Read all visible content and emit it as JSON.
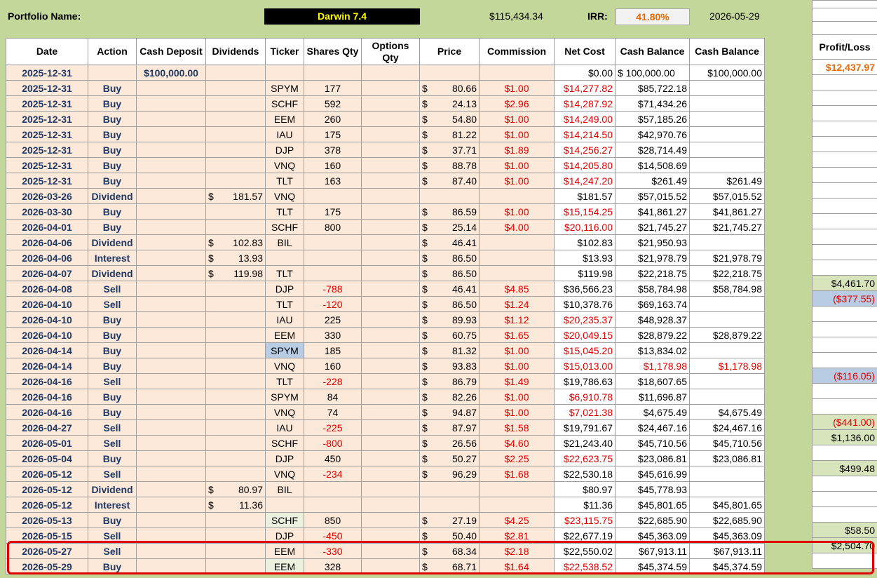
{
  "header": {
    "portfolio_label": "Portfolio Name:",
    "portfolio_name": "Darwin 7.4",
    "total_value": "$115,434.34",
    "irr_label": "IRR:",
    "irr_value": "41.80%",
    "as_of_date": "2026-05-29"
  },
  "columns": [
    "Date",
    "Action",
    "Cash Deposit",
    "Dividends",
    "Ticker",
    "Shares Qty",
    "Options Qty",
    "Price",
    "Commission",
    "Net Cost",
    "Cash Balance",
    "Cash Balance"
  ],
  "profit_loss_header": "Profit/Loss",
  "colors": {
    "sheet_green": "#c4d79b",
    "row_peach": "#fde9d9",
    "negative_red": "#e00000",
    "date_navy": "#1f3864",
    "highlight_red": "#e00000"
  },
  "rows": [
    {
      "date": "2025-12-31",
      "action": "",
      "deposit": "$100,000.00",
      "dividend": "",
      "ticker": "",
      "shares": "",
      "options": "",
      "price": "",
      "commission": "",
      "net_cost": "$0.00",
      "cash_balance": "$ 100,000.00",
      "cash_balance2": "$100,000.00",
      "pl": "$12,437.97",
      "pl_style": "orange"
    },
    {
      "date": "2025-12-31",
      "action": "Buy",
      "deposit": "",
      "dividend": "",
      "ticker": "SPYM",
      "shares": "177",
      "options": "",
      "price": "80.66",
      "commission": "$1.00",
      "net_cost": "$14,277.82",
      "cash_balance": "$85,722.18",
      "cash_balance2": "",
      "pl": ""
    },
    {
      "date": "2025-12-31",
      "action": "Buy",
      "deposit": "",
      "dividend": "",
      "ticker": "SCHF",
      "shares": "592",
      "options": "",
      "price": "24.13",
      "commission": "$2.96",
      "net_cost": "$14,287.92",
      "cash_balance": "$71,434.26",
      "cash_balance2": "",
      "pl": ""
    },
    {
      "date": "2025-12-31",
      "action": "Buy",
      "deposit": "",
      "dividend": "",
      "ticker": "EEM",
      "shares": "260",
      "options": "",
      "price": "54.80",
      "commission": "$1.00",
      "net_cost": "$14,249.00",
      "cash_balance": "$57,185.26",
      "cash_balance2": "",
      "pl": ""
    },
    {
      "date": "2025-12-31",
      "action": "Buy",
      "deposit": "",
      "dividend": "",
      "ticker": "IAU",
      "shares": "175",
      "options": "",
      "price": "81.22",
      "commission": "$1.00",
      "net_cost": "$14,214.50",
      "cash_balance": "$42,970.76",
      "cash_balance2": "",
      "pl": ""
    },
    {
      "date": "2025-12-31",
      "action": "Buy",
      "deposit": "",
      "dividend": "",
      "ticker": "DJP",
      "shares": "378",
      "options": "",
      "price": "37.71",
      "commission": "$1.89",
      "net_cost": "$14,256.27",
      "cash_balance": "$28,714.49",
      "cash_balance2": "",
      "pl": ""
    },
    {
      "date": "2025-12-31",
      "action": "Buy",
      "deposit": "",
      "dividend": "",
      "ticker": "VNQ",
      "shares": "160",
      "options": "",
      "price": "88.78",
      "commission": "$1.00",
      "net_cost": "$14,205.80",
      "cash_balance": "$14,508.69",
      "cash_balance2": "",
      "pl": ""
    },
    {
      "date": "2025-12-31",
      "action": "Buy",
      "deposit": "",
      "dividend": "",
      "ticker": "TLT",
      "shares": "163",
      "options": "",
      "price": "87.40",
      "commission": "$1.00",
      "net_cost": "$14,247.20",
      "cash_balance": "$261.49",
      "cash_balance2": "$261.49",
      "pl": ""
    },
    {
      "date": "2026-03-26",
      "action": "Dividend",
      "deposit": "",
      "dividend": "181.57",
      "ticker": "VNQ",
      "shares": "",
      "options": "",
      "price": "",
      "commission": "",
      "net_cost": "$181.57",
      "cash_balance": "$57,015.52",
      "cash_balance2": "$57,015.52",
      "pl": ""
    },
    {
      "date": "2026-03-30",
      "action": "Buy",
      "deposit": "",
      "dividend": "",
      "ticker": "TLT",
      "shares": "175",
      "options": "",
      "price": "86.59",
      "commission": "$1.00",
      "net_cost": "$15,154.25",
      "cash_balance": "$41,861.27",
      "cash_balance2": "$41,861.27",
      "pl": ""
    },
    {
      "date": "2026-04-01",
      "action": "Buy",
      "deposit": "",
      "dividend": "",
      "ticker": "SCHF",
      "shares": "800",
      "options": "",
      "price": "25.14",
      "commission": "$4.00",
      "net_cost": "$20,116.00",
      "cash_balance": "$21,745.27",
      "cash_balance2": "$21,745.27",
      "pl": ""
    },
    {
      "date": "2026-04-06",
      "action": "Dividend",
      "deposit": "",
      "dividend": "102.83",
      "ticker": "BIL",
      "shares": "",
      "options": "",
      "price": "46.41",
      "commission": "",
      "net_cost": "$102.83",
      "cash_balance": "$21,950.93",
      "cash_balance2": "",
      "pl": ""
    },
    {
      "date": "2026-04-06",
      "action": "Interest",
      "deposit": "",
      "dividend": "13.93",
      "ticker": "",
      "shares": "",
      "options": "",
      "price": "86.50",
      "commission": "",
      "net_cost": "$13.93",
      "cash_balance": "$21,978.79",
      "cash_balance2": "$21,978.79",
      "pl": ""
    },
    {
      "date": "2026-04-07",
      "action": "Dividend",
      "deposit": "",
      "dividend": "119.98",
      "ticker": "TLT",
      "shares": "",
      "options": "",
      "price": "86.50",
      "commission": "",
      "net_cost": "$119.98",
      "cash_balance": "$22,218.75",
      "cash_balance2": "$22,218.75",
      "pl": ""
    },
    {
      "date": "2026-04-08",
      "action": "Sell",
      "deposit": "",
      "dividend": "",
      "ticker": "DJP",
      "shares": "-788",
      "options": "",
      "price": "46.41",
      "commission": "$4.85",
      "net_cost": "$36,566.23",
      "cash_balance": "$58,784.98",
      "cash_balance2": "$58,784.98",
      "pl": "$4,461.70",
      "pl_style": "green"
    },
    {
      "date": "2026-04-10",
      "action": "Sell",
      "deposit": "",
      "dividend": "",
      "ticker": "TLT",
      "shares": "-120",
      "options": "",
      "price": "86.50",
      "commission": "$1.24",
      "net_cost": "$10,378.76",
      "cash_balance": "$69,163.74",
      "cash_balance2": "",
      "pl": "($377.55)",
      "pl_style": "blue"
    },
    {
      "date": "2026-04-10",
      "action": "Buy",
      "deposit": "",
      "dividend": "",
      "ticker": "IAU",
      "shares": "225",
      "options": "",
      "price": "89.93",
      "commission": "$1.12",
      "net_cost": "$20,235.37",
      "cash_balance": "$48,928.37",
      "cash_balance2": "",
      "pl": ""
    },
    {
      "date": "2026-04-10",
      "action": "Buy",
      "deposit": "",
      "dividend": "",
      "ticker": "EEM",
      "shares": "330",
      "options": "",
      "price": "60.75",
      "commission": "$1.65",
      "net_cost": "$20,049.15",
      "cash_balance": "$28,879.22",
      "cash_balance2": "$28,879.22",
      "pl": ""
    },
    {
      "date": "2026-04-14",
      "action": "Buy",
      "deposit": "",
      "dividend": "",
      "ticker": "SPYM",
      "ticker_style": "blue",
      "shares": "185",
      "options": "",
      "price": "81.32",
      "commission": "$1.00",
      "net_cost": "$15,045.20",
      "cash_balance": "$13,834.02",
      "cash_balance2": "",
      "pl": ""
    },
    {
      "date": "2026-04-14",
      "action": "Buy",
      "deposit": "",
      "dividend": "",
      "ticker": "VNQ",
      "shares": "160",
      "options": "",
      "price": "93.83",
      "commission": "$1.00",
      "net_cost": "$15,013.00",
      "cash_balance": "$1,178.98",
      "cash_balance_red": true,
      "cash_balance2": "$1,178.98",
      "cash_balance2_red": true,
      "pl": ""
    },
    {
      "date": "2026-04-16",
      "action": "Sell",
      "deposit": "",
      "dividend": "",
      "ticker": "TLT",
      "shares": "-228",
      "options": "",
      "price": "86.79",
      "commission": "$1.49",
      "net_cost": "$19,786.63",
      "cash_balance": "$18,607.65",
      "cash_balance2": "",
      "pl": "($116.05)",
      "pl_style": "blue"
    },
    {
      "date": "2026-04-16",
      "action": "Buy",
      "deposit": "",
      "dividend": "",
      "ticker": "SPYM",
      "shares": "84",
      "options": "",
      "price": "82.26",
      "commission": "$1.00",
      "net_cost": "$6,910.78",
      "cash_balance": "$11,696.87",
      "cash_balance2": "",
      "pl": ""
    },
    {
      "date": "2026-04-16",
      "action": "Buy",
      "deposit": "",
      "dividend": "",
      "ticker": "VNQ",
      "shares": "74",
      "options": "",
      "price": "94.87",
      "commission": "$1.00",
      "net_cost": "$7,021.38",
      "cash_balance": "$4,675.49",
      "cash_balance2": "$4,675.49",
      "pl": ""
    },
    {
      "date": "2026-04-27",
      "action": "Sell",
      "deposit": "",
      "dividend": "",
      "ticker": "IAU",
      "shares": "-225",
      "options": "",
      "price": "87.97",
      "commission": "$1.58",
      "net_cost": "$19,791.67",
      "cash_balance": "$24,467.16",
      "cash_balance2": "$24,467.16",
      "pl": "($441.00)",
      "pl_style": "green"
    },
    {
      "date": "2026-05-01",
      "action": "Sell",
      "deposit": "",
      "dividend": "",
      "ticker": "SCHF",
      "shares": "-800",
      "options": "",
      "price": "26.56",
      "commission": "$4.60",
      "net_cost": "$21,243.40",
      "cash_balance": "$45,710.56",
      "cash_balance2": "$45,710.56",
      "pl": "$1,136.00",
      "pl_style": "green"
    },
    {
      "date": "2026-05-04",
      "action": "Buy",
      "deposit": "",
      "dividend": "",
      "ticker": "DJP",
      "shares": "450",
      "options": "",
      "price": "50.27",
      "commission": "$2.25",
      "net_cost": "$22,623.75",
      "cash_balance": "$23,086.81",
      "cash_balance2": "$23,086.81",
      "pl": ""
    },
    {
      "date": "2026-05-12",
      "action": "Sell",
      "deposit": "",
      "dividend": "",
      "ticker": "VNQ",
      "shares": "-234",
      "options": "",
      "price": "96.29",
      "commission": "$1.68",
      "net_cost": "$22,530.18",
      "cash_balance": "$45,616.99",
      "cash_balance2": "",
      "pl": "$499.48",
      "pl_style": "green"
    },
    {
      "date": "2026-05-12",
      "action": "Dividend",
      "deposit": "",
      "dividend": "80.97",
      "ticker": "BIL",
      "shares": "",
      "options": "",
      "price": "",
      "commission": "",
      "net_cost": "$80.97",
      "cash_balance": "$45,778.93",
      "cash_balance2": "",
      "pl": ""
    },
    {
      "date": "2026-05-12",
      "action": "Interest",
      "deposit": "",
      "dividend": "11.36",
      "ticker": "",
      "shares": "",
      "options": "",
      "price": "",
      "commission": "",
      "net_cost": "$11.36",
      "cash_balance": "$45,801.65",
      "cash_balance2": "$45,801.65",
      "pl": ""
    },
    {
      "date": "2026-05-13",
      "action": "Buy",
      "deposit": "",
      "dividend": "",
      "ticker": "SCHF",
      "ticker_style": "green",
      "shares": "850",
      "options": "",
      "price": "27.19",
      "commission": "$4.25",
      "net_cost": "$23,115.75",
      "cash_balance": "$22,685.90",
      "cash_balance2": "$22,685.90",
      "pl": ""
    },
    {
      "date": "2026-05-15",
      "action": "Sell",
      "deposit": "",
      "dividend": "",
      "ticker": "DJP",
      "shares": "-450",
      "options": "",
      "price": "50.40",
      "commission": "$2.81",
      "net_cost": "$22,677.19",
      "cash_balance": "$45,363.09",
      "cash_balance2": "$45,363.09",
      "pl": "$58.50",
      "pl_style": "green"
    },
    {
      "date": "2026-05-27",
      "action": "Sell",
      "deposit": "",
      "dividend": "",
      "ticker": "EEM",
      "shares": "-330",
      "options": "",
      "price": "68.34",
      "commission": "$2.18",
      "net_cost": "$22,550.02",
      "cash_balance": "$67,913.11",
      "cash_balance2": "$67,913.11",
      "pl": "$2,504.70",
      "pl_style": "green"
    },
    {
      "date": "2026-05-29",
      "action": "Buy",
      "deposit": "",
      "dividend": "",
      "ticker": "EEM",
      "ticker_style": "green",
      "shares": "328",
      "options": "",
      "price": "68.71",
      "commission": "$1.64",
      "net_cost": "$22,538.52",
      "cash_balance": "$45,374.59",
      "cash_balance2": "$45,374.59",
      "pl": ""
    }
  ]
}
